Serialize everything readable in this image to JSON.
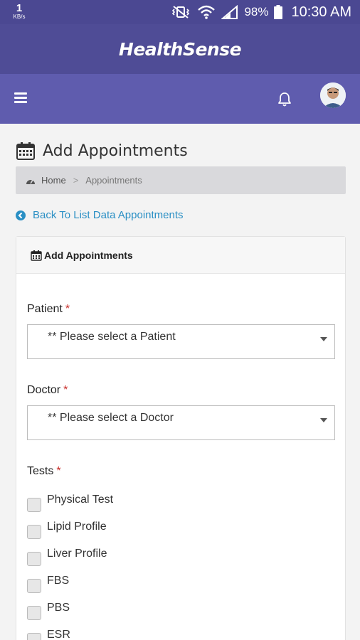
{
  "status_bar": {
    "net_speed": "1",
    "net_unit": "KB/s",
    "battery": "98%",
    "time": "10:30 AM"
  },
  "app": {
    "brand": "HealthSense"
  },
  "page": {
    "title": "Add Appointments",
    "breadcrumb": {
      "home": "Home",
      "separator": ">",
      "current": "Appointments"
    },
    "back_link": "Back To List Data Appointments"
  },
  "form": {
    "header": "Add Appointments",
    "patient": {
      "label": "Patient",
      "required": "*",
      "value": "** Please select a Patient"
    },
    "doctor": {
      "label": "Doctor",
      "required": "*",
      "value": "** Please select a Doctor"
    },
    "tests": {
      "label": "Tests",
      "required": "*",
      "items": [
        {
          "label": "Physical Test"
        },
        {
          "label": "Lipid Profile"
        },
        {
          "label": "Liver Profile"
        },
        {
          "label": "FBS"
        },
        {
          "label": "PBS"
        },
        {
          "label": "ESR"
        }
      ]
    }
  }
}
